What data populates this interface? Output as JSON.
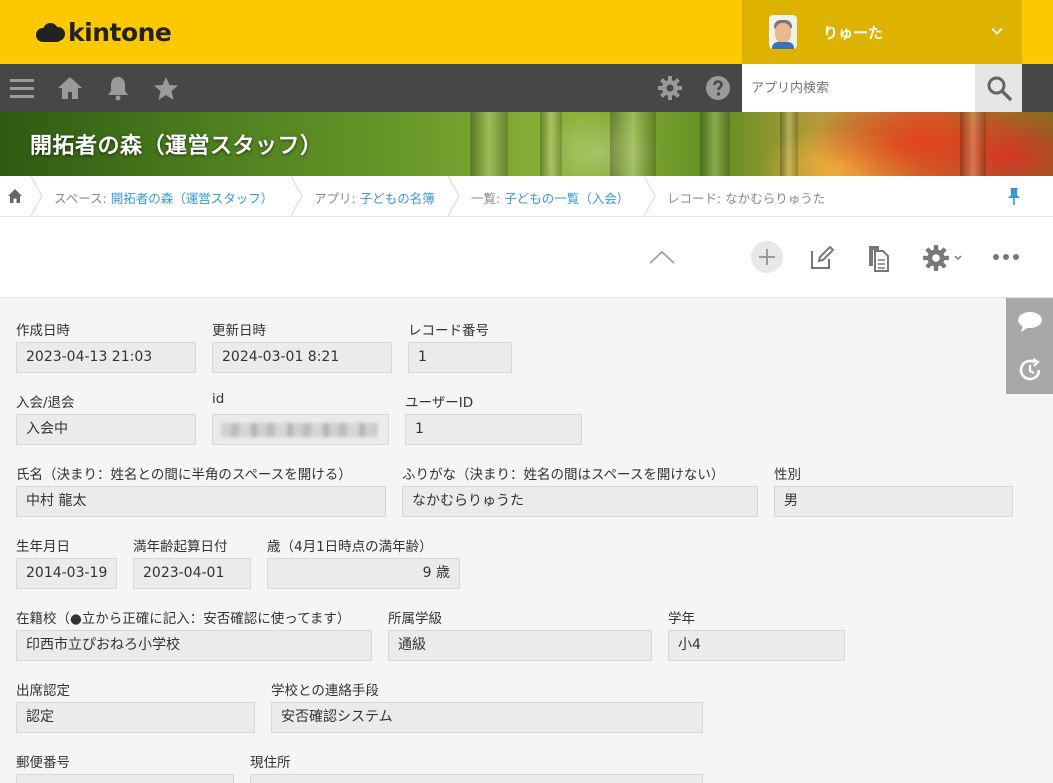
{
  "header": {
    "logo_text": "kintone",
    "user_name": "りゅーた",
    "brand_color": "#fcc800"
  },
  "toolbar": {
    "icons": [
      "menu-icon",
      "home-icon",
      "bell-icon",
      "star-icon",
      "gear-icon",
      "help-icon"
    ],
    "search_placeholder": "アプリ内検索"
  },
  "banner": {
    "title": "開拓者の森（運営スタッフ）"
  },
  "breadcrumb": {
    "space_label": "スペース:",
    "space_link": "開拓者の森（運営スタッフ）",
    "app_label": "アプリ:",
    "app_link": "子どもの名簿",
    "list_label": "一覧:",
    "list_link": "子どもの一覧（入会）",
    "record_label": "レコード:",
    "record_name": "なかむらりゅうた"
  },
  "record": {
    "created_label": "作成日時",
    "created_value": "2023-04-13 21:03",
    "updated_label": "更新日時",
    "updated_value": "2024-03-01 8:21",
    "record_no_label": "レコード番号",
    "record_no_value": "1",
    "membership_label": "入会/退会",
    "membership_value": "入会中",
    "id_label": "id",
    "id_value": "",
    "userid_label": "ユーザーID",
    "userid_value": "1",
    "name_label": "氏名（決まり：姓名との間に半角のスペースを開ける）",
    "name_value": "中村 龍太",
    "kana_label": "ふりがな（決まり：姓名の間はスペースを開けない）",
    "kana_value": "なかむらりゅうた",
    "gender_label": "性別",
    "gender_value": "男",
    "birth_label": "生年月日",
    "birth_value": "2014-03-19",
    "age_base_label": "満年齢起算日付",
    "age_base_value": "2023-04-01",
    "age_label": "歳（4月1日時点の満年齢）",
    "age_value": "9 歳",
    "school_label": "在籍校（●立から正確に記入：安否確認に使ってます）",
    "school_value": "印西市立ぴおねろ小学校",
    "class_label": "所属学級",
    "class_value": "通級",
    "grade_label": "学年",
    "grade_value": "小4",
    "attend_label": "出席認定",
    "attend_value": "認定",
    "contact_label": "学校との連絡手段",
    "contact_value": "安否確認システム",
    "postal_label": "郵便番号",
    "address_label": "現住所"
  }
}
